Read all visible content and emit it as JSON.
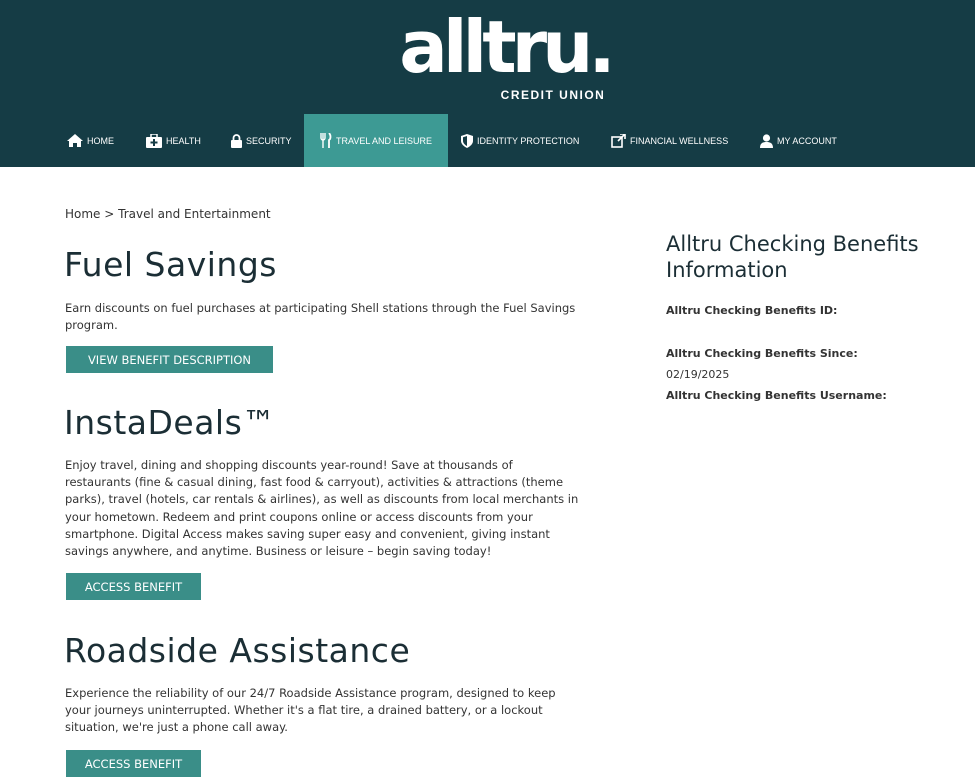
{
  "header": {
    "logo_word": "alltru.",
    "logo_sub": "CREDIT UNION",
    "nav": [
      {
        "label": "Home",
        "icon": "home-icon"
      },
      {
        "label": "Health",
        "icon": "medical-kit-icon"
      },
      {
        "label": "Security",
        "icon": "lock-icon"
      },
      {
        "label": "Travel and Leisure",
        "icon": "fork-knife-icon",
        "active": true
      },
      {
        "label": "Identity Protection",
        "icon": "shield-icon"
      },
      {
        "label": "Financial Wellness",
        "icon": "external-link-icon"
      },
      {
        "label": "My Account",
        "icon": "user-icon"
      }
    ]
  },
  "breadcrumb": {
    "home": "Home",
    "separator": ">",
    "current": "Travel and Entertainment"
  },
  "sections": [
    {
      "title": "Fuel Savings",
      "description": "Earn discounts on fuel purchases at participating Shell stations through the Fuel Savings program.",
      "button": "View Benefit Description"
    },
    {
      "title": "InstaDeals™",
      "description": "Enjoy travel, dining and shopping discounts year-round! Save at thousands of restaurants (fine & casual dining, fast food & carryout), activities & attractions (theme parks), travel (hotels, car rentals & airlines), as well as discounts from local merchants in your hometown. Redeem and print coupons online or access discounts from your smartphone. Digital Access makes saving super easy and convenient, giving instant savings anywhere, and anytime. Business or leisure – begin saving today!",
      "button": "Access Benefit"
    },
    {
      "title": "Roadside Assistance",
      "description": "Experience the reliability of our 24/7 Roadside Assistance program, designed to keep your journeys uninterrupted. Whether it's a flat tire, a drained battery, or a lockout situation, we're just a phone call away.",
      "button": "Access Benefit"
    }
  ],
  "sidebar": {
    "title": "Alltru Checking Benefits Information",
    "id_label": "Alltru Checking Benefits ID:",
    "id_value": "",
    "since_label": "Alltru Checking Benefits Since:",
    "since_value": "02/19/2025",
    "username_label": "Alltru Checking Benefits Username:",
    "username_value": ""
  },
  "colors": {
    "header_bg": "#153c45",
    "accent": "#3d9a94",
    "button": "#3a8e88"
  }
}
